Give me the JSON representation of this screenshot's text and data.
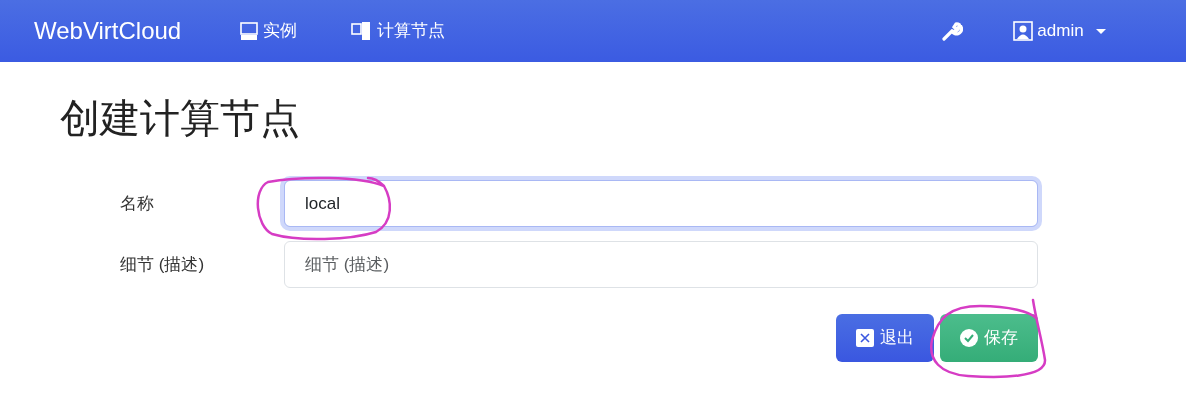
{
  "navbar": {
    "brand": "WebVirtCloud",
    "links": [
      {
        "label": "实例"
      },
      {
        "label": "计算节点"
      }
    ],
    "user": {
      "label": "admin"
    }
  },
  "page_title": "创建计算节点",
  "form": {
    "fields": [
      {
        "label": "名称",
        "value": "local",
        "focused": true
      },
      {
        "label": "细节 (描述)",
        "placeholder": "细节 (描述)",
        "focused": false
      }
    ],
    "buttons": [
      {
        "label": "退出",
        "kind": "cancel"
      },
      {
        "label": "保存",
        "kind": "save"
      }
    ]
  },
  "annotations": [
    {
      "kind": "freehand-circle"
    },
    {
      "kind": "freehand-circle"
    }
  ]
}
